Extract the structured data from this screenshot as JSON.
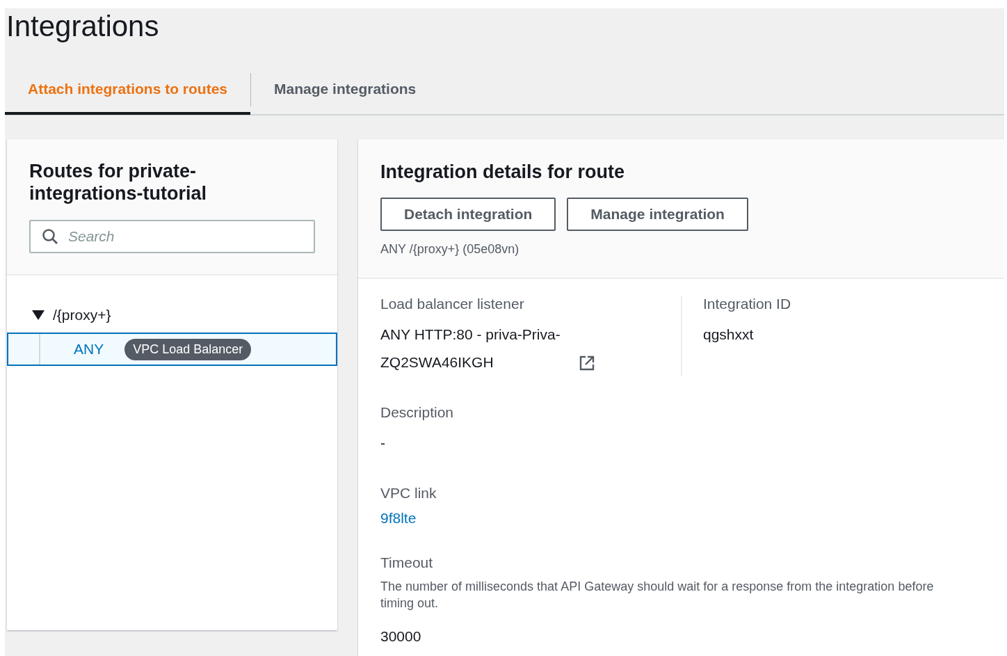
{
  "page": {
    "title": "Integrations"
  },
  "tabs": [
    {
      "label": "Attach integrations to routes",
      "selected": true
    },
    {
      "label": "Manage integrations",
      "selected": false
    }
  ],
  "routes_panel": {
    "title": "Routes for private-integrations-tutorial",
    "search": {
      "placeholder": "Search"
    },
    "tree": [
      {
        "path": "/{proxy+}",
        "expanded": true,
        "children": [
          {
            "method": "ANY",
            "badge": "VPC Load Balancer",
            "selected": true
          }
        ]
      }
    ]
  },
  "details_panel": {
    "title": "Integration details for route",
    "buttons": [
      "Detach integration",
      "Manage integration"
    ],
    "route_summary": "ANY /{proxy+} (05e08vn)",
    "fields": [
      {
        "label": "Load balancer listener",
        "value": "ANY HTTP:80 - priva-Priva-ZQ2SWA46IKGH",
        "kind": "external"
      },
      {
        "label": "Integration ID",
        "value": "qgshxxt",
        "kind": "text"
      }
    ],
    "sections": [
      {
        "label": "Description",
        "value": "-",
        "kind": "text"
      },
      {
        "label": "VPC link",
        "value": "9f8lte",
        "kind": "link"
      },
      {
        "label": "Timeout",
        "description": "The number of milliseconds that API Gateway should wait for a response from the integration before timing out.",
        "value": "30000",
        "kind": "text"
      }
    ]
  }
}
